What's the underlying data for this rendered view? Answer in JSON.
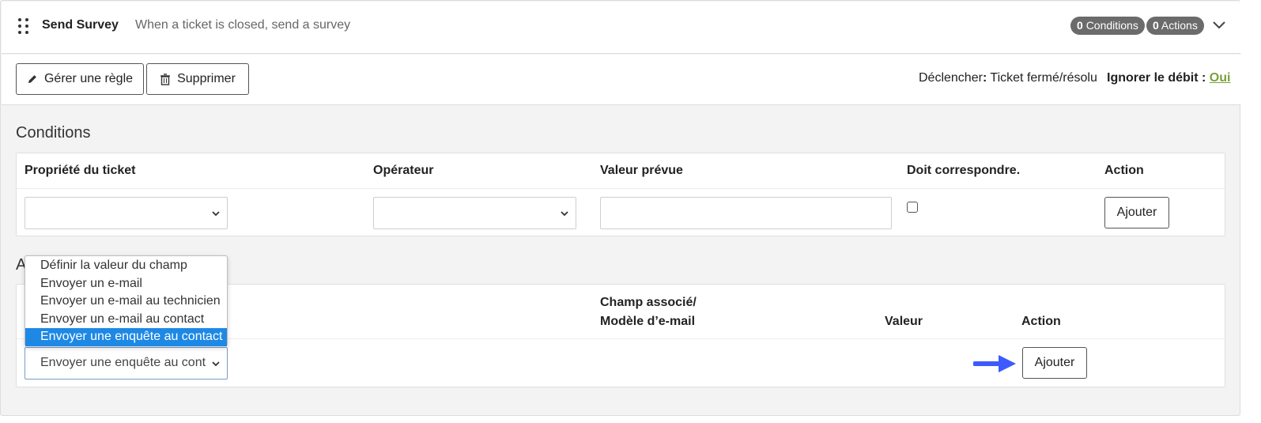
{
  "header": {
    "title": "Send Survey",
    "subtitle": "When a ticket is closed, send a survey",
    "conditions_count": "0",
    "conditions_label": "Conditions",
    "actions_count": "0",
    "actions_label": "Actions"
  },
  "toolbar": {
    "manage_label": "Gérer une règle",
    "delete_label": "Supprimer",
    "trigger_label": "Déclencher",
    "trigger_sep": ":",
    "trigger_value": " Ticket fermé/résolu",
    "ignore_label": "Ignorer le débit :",
    "ignore_value": "Oui"
  },
  "conditions": {
    "title": "Conditions",
    "columns": [
      "Propriété du ticket",
      "Opérateur",
      "Valeur prévue",
      "Doit correspondre.",
      "Action"
    ],
    "row": {
      "property": "",
      "operator": "",
      "value": "",
      "must_match": false,
      "add_label": "Ajouter"
    }
  },
  "actions": {
    "title_visible": "A",
    "columns": {
      "field_line1": "Champ associé/",
      "field_line2": "Modèle d’e-mail",
      "value": "Valeur",
      "action": "Action"
    },
    "row": {
      "action_type": "Envoyer une enquête au cont",
      "add_label": "Ajouter"
    },
    "dropdown_options": [
      "Définir la valeur du champ",
      "Envoyer un e-mail",
      "Envoyer un e-mail au technicien",
      "Envoyer un e-mail au contact",
      "Envoyer une enquête au contact"
    ],
    "dropdown_selected_index": 4
  },
  "colors": {
    "accent": "#1e88e5",
    "badge": "#6b6b6b",
    "link_green": "#7aa03a",
    "arrow": "#3d5afe"
  }
}
